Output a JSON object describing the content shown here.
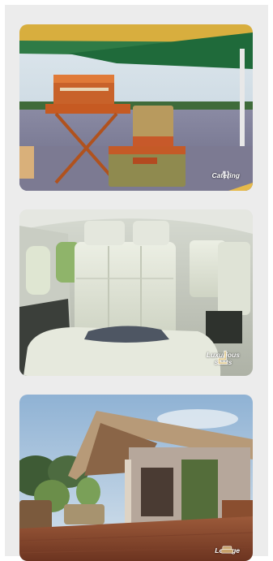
{
  "cards": [
    {
      "id": "catering",
      "label": "Catering",
      "icon": "utensils-icon",
      "accent": "#cf6a2a"
    },
    {
      "id": "seats",
      "label_line1": "Luxurious",
      "label_line2": "seats",
      "icon": "seat-icon",
      "accent": "#e9e2cf"
    },
    {
      "id": "lounge",
      "label": "Lounge",
      "icon": "sofa-icon",
      "accent": "#c7a26b"
    }
  ]
}
